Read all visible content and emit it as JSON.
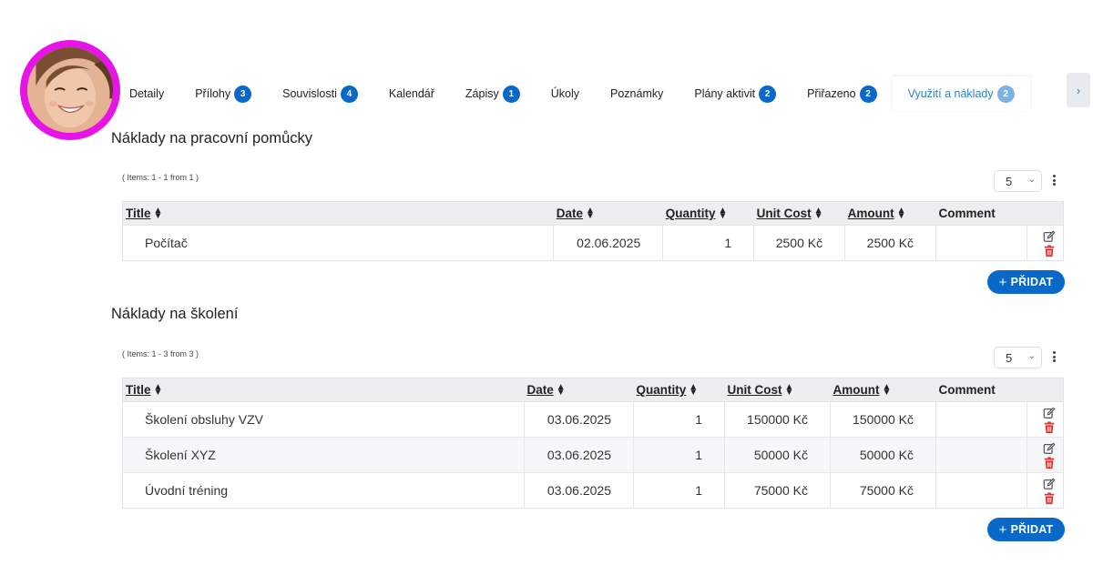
{
  "tabs": [
    {
      "label": "Detaily",
      "badge": null
    },
    {
      "label": "Přílohy",
      "badge": "3"
    },
    {
      "label": "Souvislosti",
      "badge": "4"
    },
    {
      "label": "Kalendář",
      "badge": null
    },
    {
      "label": "Zápisy",
      "badge": "1"
    },
    {
      "label": "Úkoly",
      "badge": null
    },
    {
      "label": "Poznámky",
      "badge": null
    },
    {
      "label": "Plány aktivit",
      "badge": "2"
    },
    {
      "label": "Přiřazeno",
      "badge": "2"
    },
    {
      "label": "Využití a náklady",
      "badge": "2",
      "active": true
    }
  ],
  "tab_scroll_icon": "›",
  "section1": {
    "title": "Náklady na pracovní pomůcky",
    "items_info": "( Items: 1 - 1 from 1 )",
    "page_size": "5",
    "headers": [
      "Title",
      "Date",
      "Quantity",
      "Unit Cost",
      "Amount",
      "Comment"
    ],
    "rows": [
      {
        "title": "Počítač",
        "date": "02.06.2025",
        "quantity": "1",
        "unit_cost": "2500 Kč",
        "amount": "2500 Kč",
        "comment": ""
      }
    ],
    "add_label": "PŘIDAT"
  },
  "section2": {
    "title": "Náklady na školení",
    "items_info": "( Items: 1 - 3 from 3 )",
    "page_size": "5",
    "headers": [
      "Title",
      "Date",
      "Quantity",
      "Unit Cost",
      "Amount",
      "Comment"
    ],
    "rows": [
      {
        "title": "Školení obsluhy VZV",
        "date": "03.06.2025",
        "quantity": "1",
        "unit_cost": "150000 Kč",
        "amount": "150000 Kč",
        "comment": ""
      },
      {
        "title": "Školení XYZ",
        "date": "03.06.2025",
        "quantity": "1",
        "unit_cost": "50000 Kč",
        "amount": "50000 Kč",
        "comment": ""
      },
      {
        "title": "Úvodní tréning",
        "date": "03.06.2025",
        "quantity": "1",
        "unit_cost": "75000 Kč",
        "amount": "75000 Kč",
        "comment": ""
      }
    ],
    "add_label": "PŘIDAT"
  },
  "colors": {
    "accent": "#0a68c8",
    "avatar_ring": "#e614e6",
    "delete": "#e03131",
    "active_tab": "#2f7fc9"
  },
  "icons": {
    "edit": "edit-icon",
    "delete": "trash-icon",
    "sort": "sort-icon",
    "more": "kebab-menu-icon"
  }
}
